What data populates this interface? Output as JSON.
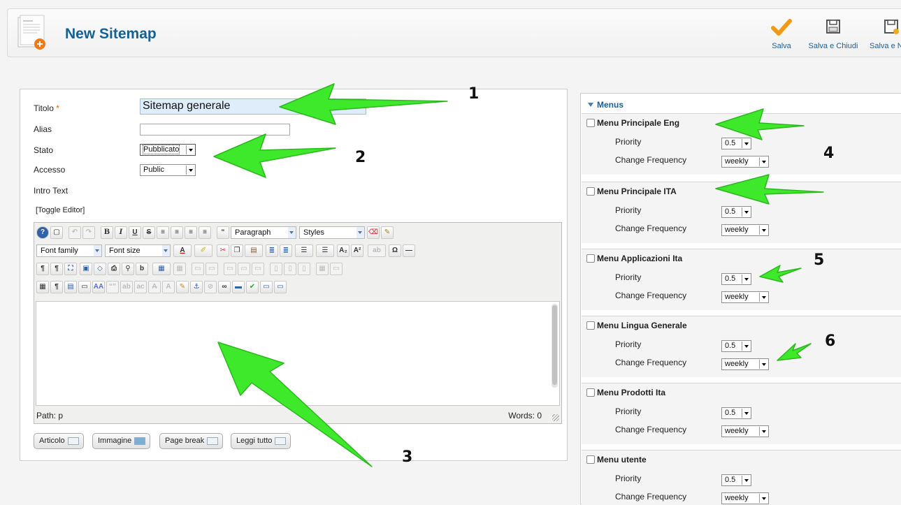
{
  "header": {
    "title": "New Sitemap",
    "toolbar": [
      {
        "label": "Salva",
        "icon": "checkmark-icon"
      },
      {
        "label": "Salva e Chiudi",
        "icon": "save-icon"
      },
      {
        "label": "Salva e N",
        "icon": "save-new-icon"
      }
    ]
  },
  "form": {
    "titolo_label": "Titolo",
    "required_mark": "*",
    "titolo_value": "Sitemap generale",
    "alias_label": "Alias",
    "alias_value": "",
    "stato_label": "Stato",
    "stato_value": "Pubblicato",
    "accesso_label": "Accesso",
    "accesso_value": "Public",
    "intro_label": "Intro Text",
    "toggle_editor": "[Toggle Editor]"
  },
  "editor": {
    "format_select": "Paragraph",
    "styles_select": "Styles",
    "font_family": "Font family",
    "font_size": "Font size",
    "path_label": "Path: p",
    "words_label": "Words: 0",
    "buttons": [
      "Articolo",
      "Immagine",
      "Page break",
      "Leggi tutto"
    ]
  },
  "menus": {
    "header": "Menus",
    "priority_label": "Priority",
    "frequency_label": "Change Frequency",
    "items": [
      {
        "name": "Menu Principale Eng",
        "priority": "0.5",
        "frequency": "weekly"
      },
      {
        "name": "Menu Principale ITA",
        "priority": "0.5",
        "frequency": "weekly"
      },
      {
        "name": "Menu Applicazioni Ita",
        "priority": "0.5",
        "frequency": "weekly"
      },
      {
        "name": "Menu Lingua Generale",
        "priority": "0.5",
        "frequency": "weekly"
      },
      {
        "name": "Menu Prodotti Ita",
        "priority": "0.5",
        "frequency": "weekly"
      },
      {
        "name": "Menu utente",
        "priority": "0.5",
        "frequency": "weekly"
      }
    ]
  },
  "annotations": [
    "1",
    "2",
    "3",
    "4",
    "5",
    "6"
  ],
  "colors": {
    "accent": "#146295",
    "arrow": "#3ee82a",
    "required": "#e8630a"
  }
}
